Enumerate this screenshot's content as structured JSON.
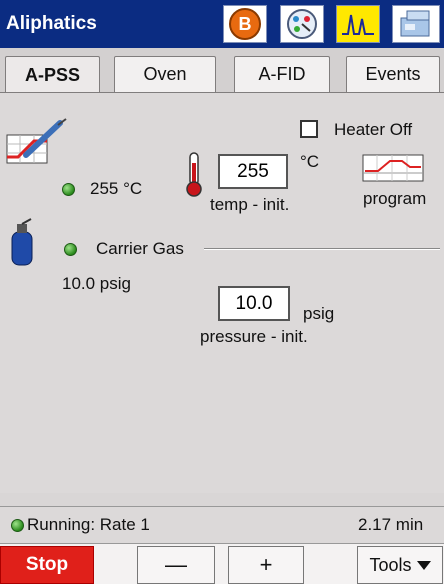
{
  "window": {
    "title": "Aliphatics"
  },
  "toolbar_icons": [
    "b-circle-icon",
    "gauge-icon",
    "chromatogram-icon",
    "instrument-icon"
  ],
  "tabs": [
    {
      "label": "A-PSS",
      "active": true
    },
    {
      "label": "Oven",
      "active": false
    },
    {
      "label": "A-FID",
      "active": false
    },
    {
      "label": "Events",
      "active": false
    }
  ],
  "heater": {
    "label": "Heater Off",
    "checked": false
  },
  "oven": {
    "actual_temp": "255 °C",
    "temp_init_value": "255",
    "temp_unit": "°C",
    "temp_init_label": "temp - init.",
    "program_label": "program"
  },
  "carrier": {
    "title": "Carrier Gas",
    "actual_pressure": "10.0 psig",
    "pressure_init_value": "10.0",
    "pressure_unit": "psig",
    "pressure_init_label": "pressure - init."
  },
  "status": {
    "text": "Running: Rate 1",
    "time": "2.17 min"
  },
  "bottom": {
    "stop": "Stop",
    "minus": "—",
    "plus": "+",
    "tools": "Tools"
  },
  "colors": {
    "titlebar": "#0b2c82",
    "stop": "#e0201a",
    "led_green": "#2a8a1c"
  }
}
